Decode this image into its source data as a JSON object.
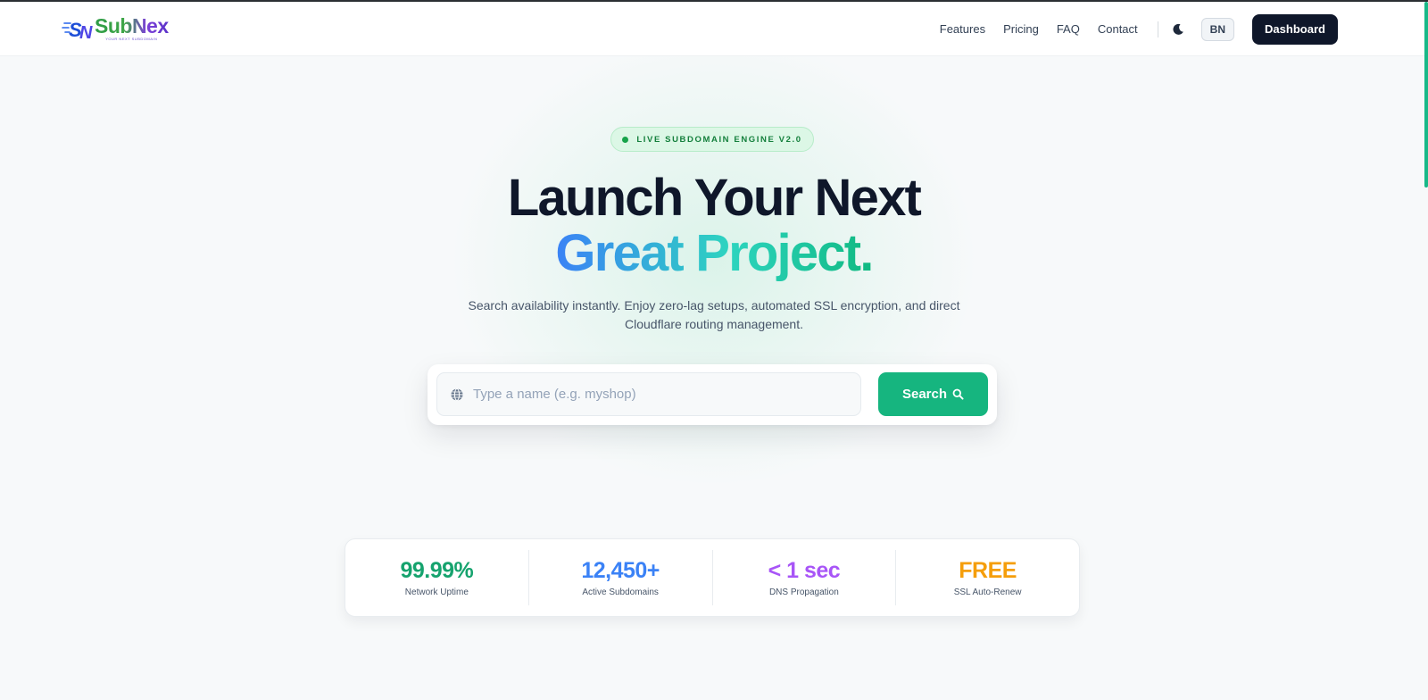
{
  "header": {
    "logo": {
      "name": "SubNex",
      "tagline": "YOUR NEXT SUBDOMAIN",
      "mark_icon": "sn-logo-icon"
    },
    "nav": [
      {
        "label": "Features"
      },
      {
        "label": "Pricing"
      },
      {
        "label": "FAQ"
      },
      {
        "label": "Contact"
      }
    ],
    "theme_icon": "moon-icon",
    "language": "BN",
    "dashboard_label": "Dashboard"
  },
  "hero": {
    "badge": "LIVE SUBDOMAIN ENGINE V2.0",
    "title_line1": "Launch Your Next",
    "title_line2": "Great Project.",
    "subtitle": "Search availability instantly. Enjoy zero-lag setups, automated SSL encryption, and direct Cloudflare routing management.",
    "search": {
      "placeholder": "Type a name (e.g. myshop)",
      "value": "",
      "button_label": "Search",
      "globe_icon": "globe-icon",
      "button_icon": "search-icon"
    }
  },
  "stats": [
    {
      "value": "99.99%",
      "label": "Network Uptime",
      "color": "#16a36e"
    },
    {
      "value": "12,450+",
      "label": "Active Subdomains",
      "color": "#3b82f6"
    },
    {
      "value": "< 1 sec",
      "label": "DNS Propagation",
      "color": "#a855f7"
    },
    {
      "value": "FREE",
      "label": "SSL Auto-Renew",
      "color": "#f59e0b"
    }
  ],
  "colors": {
    "accent": "#16b57f",
    "dark": "#0f172a",
    "gradient_start": "#3b82f6",
    "gradient_end": "#10b981"
  }
}
